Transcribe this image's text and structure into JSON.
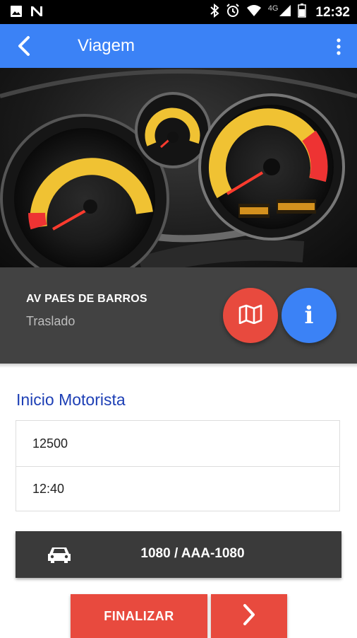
{
  "status_bar": {
    "time": "12:32",
    "network": "4G",
    "icons": [
      "image-icon",
      "notification-n-icon",
      "bluetooth-icon",
      "alarm-icon",
      "wifi-icon",
      "signal-icon",
      "battery-icon"
    ]
  },
  "app_bar": {
    "title": "Viagem",
    "back_icon": "arrow-back-icon",
    "menu_icon": "more-vert-icon",
    "color": "#3b82f6"
  },
  "hero": {
    "description_icon": "dashboard-photo"
  },
  "trip": {
    "street": "AV PAES DE BARROS",
    "type": "Traslado",
    "map_button_icon": "map-icon",
    "map_button_color": "#e84a3e",
    "info_button_label": "i",
    "info_button_color": "#3b82f6"
  },
  "section": {
    "title": "Inicio Motorista",
    "odometer_value": "12500",
    "time_value": "12:40"
  },
  "vehicle": {
    "icon": "car-icon",
    "label": "1080 / AAA-1080"
  },
  "actions": {
    "finalize_label": "FINALIZAR",
    "next_icon": "chevron-right-icon",
    "color": "#e84a3e"
  }
}
